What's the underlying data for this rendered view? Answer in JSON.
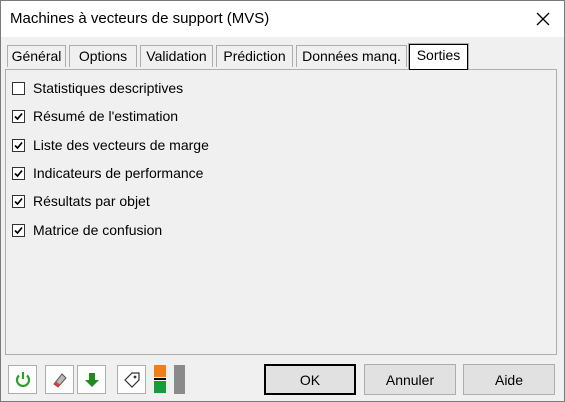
{
  "window": {
    "title": "Machines à vecteurs de support (MVS)"
  },
  "tabs": [
    {
      "label": "Général",
      "active": false
    },
    {
      "label": "Options",
      "active": false
    },
    {
      "label": "Validation",
      "active": false
    },
    {
      "label": "Prédiction",
      "active": false
    },
    {
      "label": "Données manq.",
      "active": false
    },
    {
      "label": "Sorties",
      "active": true
    }
  ],
  "outputs": [
    {
      "label": "Statistiques descriptives",
      "checked": false
    },
    {
      "label": "Résumé de l'estimation",
      "checked": true
    },
    {
      "label": "Liste des vecteurs de marge",
      "checked": true
    },
    {
      "label": "Indicateurs de performance",
      "checked": true
    },
    {
      "label": "Résultats par objet",
      "checked": true
    },
    {
      "label": "Matrice de confusion",
      "checked": true
    }
  ],
  "toolbar": {
    "icons": [
      "reset-icon",
      "eraser-icon",
      "down-arrow-icon",
      "tag-icon",
      "color-toggle-icon"
    ],
    "colors": {
      "reset": "#2e9e2e",
      "down": "#1f8a1f",
      "orange": "#f07f1a",
      "green": "#169c3c",
      "grey": "#8a8a8a"
    }
  },
  "buttons": {
    "ok": "OK",
    "cancel": "Annuler",
    "help": "Aide"
  }
}
